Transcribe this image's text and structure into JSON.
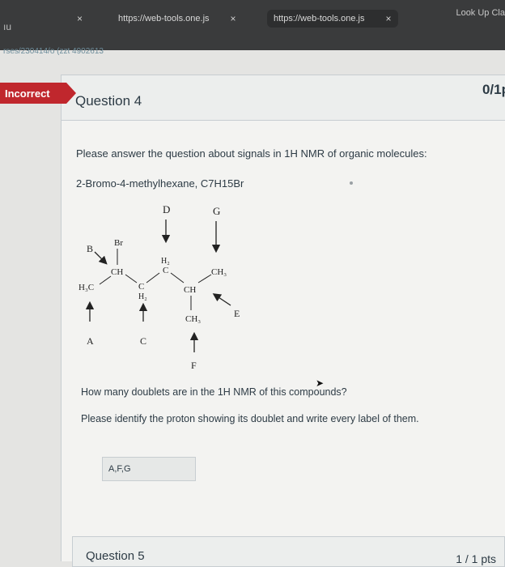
{
  "browser": {
    "menu_text": "ıu",
    "tab1_text": "https://web-tools.one.js",
    "tab2_text": "https://web-tools.one.js",
    "tab_close": "×",
    "lookup": "Look Up Cla",
    "url_fragment": "rses/230414/o  (zzt 4902613"
  },
  "quiz": {
    "status": "Incorrect",
    "question_title": "Question 4",
    "points": "0/1p",
    "prompt": "Please answer the question about signals in 1H NMR of organic molecules:",
    "compound": "2-Bromo-4-methylhexane, C7H15Br",
    "question_line1": "How many doublets are in the 1H NMR of this compounds?",
    "question_line2": "Please identify the proton showing its doublet and write every label of them.",
    "answer_value": "A,F,G",
    "next_question_title": "Question 5",
    "next_question_points": "1 / 1 pts"
  },
  "structure": {
    "labels": {
      "A": "A",
      "B": "B",
      "C": "C",
      "D": "D",
      "E": "E",
      "F": "F",
      "G": "G"
    },
    "groups": {
      "br": "Br",
      "h3c": "H₃C",
      "ch_br": "CH",
      "c_h2_left": "C",
      "h2_left": "H₂",
      "h2_top": "H₂",
      "c_top": "C",
      "ch_mid": "CH",
      "ch3_right": "CH₃",
      "ch3_bottom": "CH₃"
    }
  }
}
